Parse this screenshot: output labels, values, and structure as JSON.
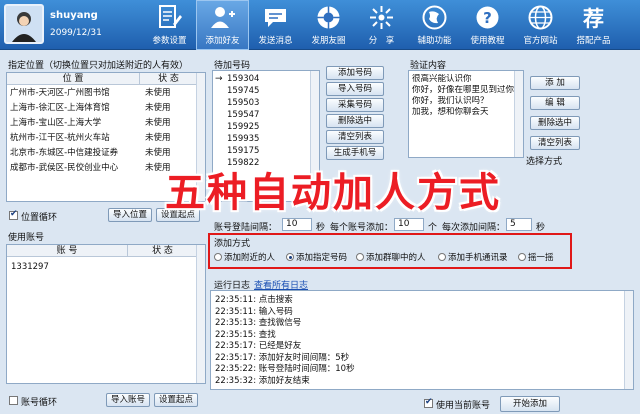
{
  "profile": {
    "username": "shuyang",
    "date": "2099/12/31"
  },
  "nav": [
    {
      "label": "参数设置",
      "icon": "document-edit-icon"
    },
    {
      "label": "添加好友",
      "icon": "add-user-icon",
      "active": true
    },
    {
      "label": "发送消息",
      "icon": "chat-bubble-icon"
    },
    {
      "label": "发朋友圈",
      "icon": "camera-shutter-icon"
    },
    {
      "label": "分　享",
      "icon": "share-icon"
    },
    {
      "label": "辅助功能",
      "icon": "globe-icon"
    },
    {
      "label": "使用教程",
      "icon": "question-help-icon"
    },
    {
      "label": "官方网站",
      "icon": "website-icon"
    },
    {
      "label": "搭配产品",
      "icon": "recommend-icon"
    }
  ],
  "location": {
    "title": "指定位置（切换位置只对加送附近的人有效）",
    "col_position": "位  置",
    "col_status": "状  态",
    "rows": [
      {
        "place": "广州市-天河区-广州图书馆",
        "status": "未使用"
      },
      {
        "place": "上海市-徐汇区-上海体育馆",
        "status": "未使用"
      },
      {
        "place": "上海市-宝山区-上海大学",
        "status": "未使用"
      },
      {
        "place": "杭州市-江干区-杭州火车站",
        "status": "未使用"
      },
      {
        "place": "北京市-东城区-中信建投证券",
        "status": "未使用"
      },
      {
        "place": "成都市-武侯区-民佼创业中心",
        "status": "未使用"
      }
    ],
    "loop_label": "位置循环",
    "import_btn": "导入位置",
    "set_btn": "设置起点"
  },
  "accounts": {
    "title": "使用账号",
    "col_account": "账  号",
    "col_status": "状  态",
    "rows": [
      {
        "account": "1331297",
        "status": ""
      }
    ],
    "loop_label": "账号循环",
    "import_btn": "导入账号",
    "set_btn": "设置起点"
  },
  "numbers": {
    "title": "待加号码",
    "items": [
      "159304",
      "159745",
      "159503",
      "159547",
      "159925",
      "159935",
      "159175",
      "159822"
    ],
    "buttons": {
      "add": "添加号码",
      "import": "导入号码",
      "collect": "采集号码",
      "delete": "删除选中",
      "clear": "清空列表",
      "generate": "生成手机号"
    }
  },
  "verify": {
    "title": "验证内容",
    "lines": [
      "很高兴能认识你",
      "你好，好像在哪里见到过你",
      "你好，我们认识吗？",
      "加我，想和你聊会天"
    ],
    "buttons": {
      "add": "添 加",
      "edit": "编 辑",
      "delete": "删除选中",
      "clear": "清空列表"
    },
    "mode_label": "选择方式"
  },
  "intervals": {
    "login_label": "账号登陆间隔：",
    "login_value": "10",
    "login_unit": "秒",
    "per_label": "每个账号添加：",
    "per_value": "10",
    "per_unit": "个",
    "each_label": "每次添加间隔：",
    "each_value": "5",
    "each_unit": "秒"
  },
  "methods": {
    "title": "添加方式",
    "options": [
      "添加附近的人",
      "添加指定号码",
      "添加群聊中的人",
      "添加手机通讯录",
      "摇一摇"
    ],
    "selected_index": 1
  },
  "log": {
    "title": "运行日志",
    "view_all": "查看所有日志",
    "entries": [
      {
        "time": "22:35:11",
        "text": "点击搜索"
      },
      {
        "time": "22:35:11",
        "text": "输入号码"
      },
      {
        "time": "22:35:13",
        "text": "查找微信号"
      },
      {
        "time": "22:35:15",
        "text": "查找"
      },
      {
        "time": "22:35:17",
        "text": "已经是好友"
      },
      {
        "time": "22:35:17",
        "text": "添加好友时间间隔：5秒"
      },
      {
        "time": "22:35:22",
        "text": "账号登陆时间间隔：10秒"
      },
      {
        "time": "22:35:32",
        "text": "添加好友结束"
      }
    ]
  },
  "footer": {
    "use_current_label": "使用当前账号",
    "start_btn": "开始添加"
  },
  "overlay_title": "五种自动加人方式",
  "colors": {
    "accent_red": "#ec1d24",
    "nav_blue": "#1f5fae"
  }
}
